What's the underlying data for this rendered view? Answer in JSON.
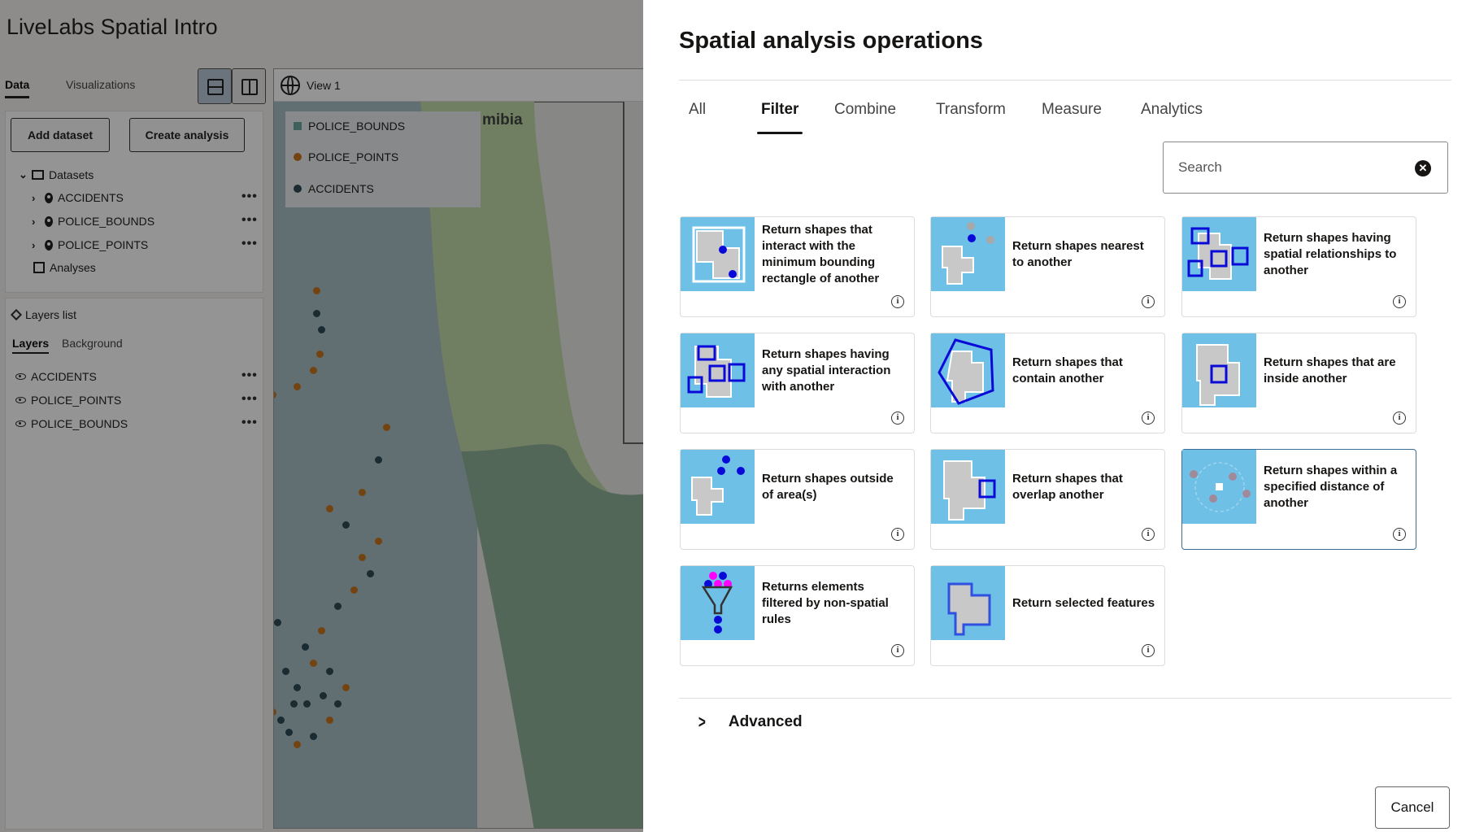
{
  "app": {
    "title": "LiveLabs Spatial Intro",
    "tabs": [
      "Data",
      "Visualizations"
    ],
    "add_dataset": "Add dataset",
    "create_analysis": "Create analysis",
    "datasets_label": "Datasets",
    "datasets": [
      "ACCIDENTS",
      "POLICE_BOUNDS",
      "POLICE_POINTS"
    ],
    "analyses_label": "Analyses",
    "layers_list_label": "Layers list",
    "layer_tabs": [
      "Layers",
      "Background"
    ],
    "layers": [
      "ACCIDENTS",
      "POLICE_POINTS",
      "POLICE_BOUNDS"
    ],
    "more_glyph": "•••"
  },
  "map": {
    "view_label": "View 1",
    "place_label": "mibia",
    "legend": [
      {
        "label": "POLICE_BOUNDS",
        "color": "#6fa5a0",
        "shape": "square"
      },
      {
        "label": "POLICE_POINTS",
        "color": "#c8741f",
        "shape": "circle"
      },
      {
        "label": "ACCIDENTS",
        "color": "#2e4a55",
        "shape": "circle"
      }
    ]
  },
  "dialog": {
    "title": "Spatial analysis operations",
    "tabs": [
      "All",
      "Filter",
      "Combine",
      "Transform",
      "Measure",
      "Analytics"
    ],
    "active_tab": "Filter",
    "search": {
      "placeholder": "Search",
      "value": ""
    },
    "clear_glyph": "✕",
    "info_glyph": "i",
    "cards": [
      {
        "label": "Return shapes that interact with the minimum bounding rectangle of another",
        "icon": "mbr-interact-icon",
        "selected": false
      },
      {
        "label": "Return shapes nearest to another",
        "icon": "nearest-icon",
        "selected": false
      },
      {
        "label": "Return shapes having spatial relationships to another",
        "icon": "spatial-relationships-icon",
        "selected": false
      },
      {
        "label": "Return shapes having any spatial interaction with another",
        "icon": "any-interaction-icon",
        "selected": false
      },
      {
        "label": "Return shapes that contain another",
        "icon": "contain-icon",
        "selected": false
      },
      {
        "label": "Return shapes that are inside another",
        "icon": "inside-icon",
        "selected": false
      },
      {
        "label": "Return shapes outside of area(s)",
        "icon": "outside-icon",
        "selected": false
      },
      {
        "label": "Return shapes that overlap another",
        "icon": "overlap-icon",
        "selected": false
      },
      {
        "label": "Return shapes within a specified distance of another",
        "icon": "within-distance-icon",
        "selected": true
      },
      {
        "label": "Returns elements filtered by non-spatial rules",
        "icon": "funnel-icon",
        "selected": false
      },
      {
        "label": "Return selected features",
        "icon": "selected-features-icon",
        "selected": false
      }
    ],
    "advanced_label": "Advanced",
    "cancel_label": "Cancel"
  },
  "colors": {
    "thumb_bg": "#6fc0e6",
    "shape_gray": "#c8c8c8",
    "shape_blue": "#0a0ad8",
    "selected_border": "#3a6e96",
    "overlay": "rgba(0,0,0,0.42)"
  }
}
